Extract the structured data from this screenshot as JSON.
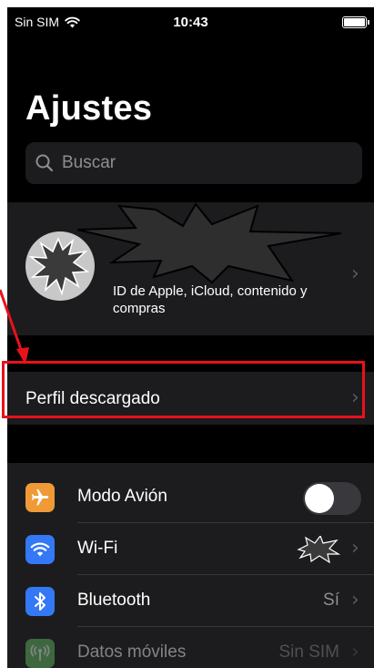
{
  "status_bar": {
    "carrier": "Sin SIM",
    "time": "10:43"
  },
  "header": {
    "title": "Ajustes"
  },
  "search": {
    "placeholder": "Buscar"
  },
  "account": {
    "subtitle": "ID de Apple, iCloud, contenido y compras"
  },
  "profile": {
    "label": "Perfil descargado"
  },
  "settings": [
    {
      "label": "Modo Avión",
      "icon": "airplane-icon",
      "color": "#f09a37",
      "control": "toggle",
      "on": false
    },
    {
      "label": "Wi-Fi",
      "icon": "wifi-icon",
      "color": "#3478f6",
      "value": ""
    },
    {
      "label": "Bluetooth",
      "icon": "bluetooth-icon",
      "color": "#3478f6",
      "value": "Sí"
    },
    {
      "label": "Datos móviles",
      "icon": "antenna-icon",
      "color": "#65c466",
      "value": "Sin SIM",
      "disabled": true
    }
  ],
  "colors": {
    "background": "#000000",
    "cell": "#1c1c1e",
    "highlight": "#e8121b",
    "secondary_text": "#8e8e93"
  }
}
